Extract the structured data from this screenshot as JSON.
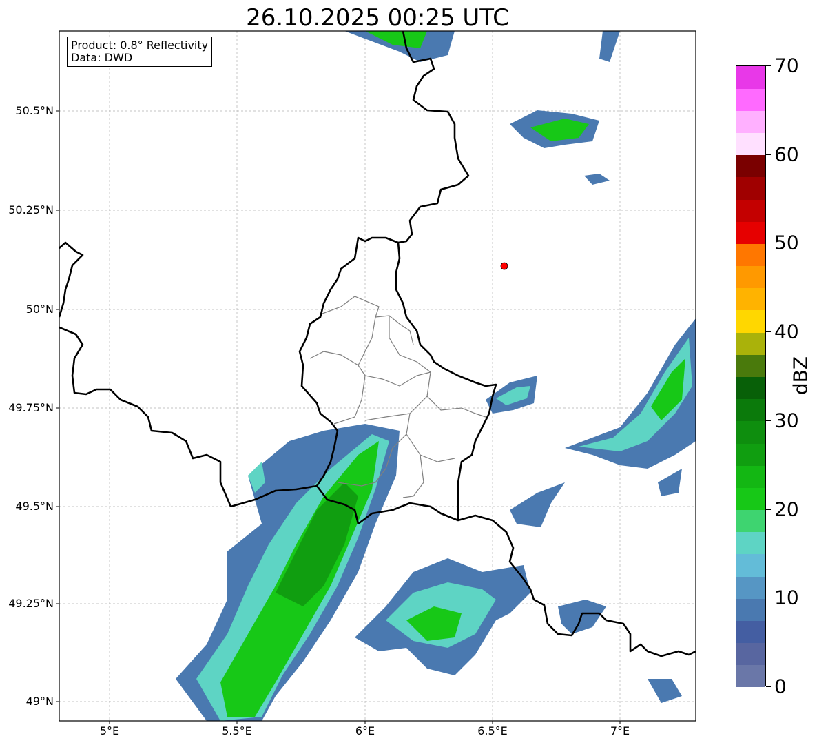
{
  "title": "26.10.2025 00:25 UTC",
  "info_box": {
    "product": "Product: 0.8° Reflectivity",
    "data": "Data: DWD"
  },
  "map": {
    "y_ticks": [
      "50.5°N",
      "50.25°N",
      "50°N",
      "49.75°N",
      "49.5°N",
      "49.25°N",
      "49°N"
    ],
    "x_ticks": [
      "5°E",
      "5.5°E",
      "6°E",
      "6.5°E",
      "7°E"
    ],
    "radar_site_color": "#ff0000",
    "border_color": "#000000",
    "district_color": "#808080"
  },
  "colorbar": {
    "unit": "dBZ",
    "tick_labels": [
      "0",
      "10",
      "20",
      "30",
      "40",
      "50",
      "60",
      "70"
    ],
    "colors": [
      "#6a77a8",
      "#5866a0",
      "#445ea2",
      "#4a79b0",
      "#5696c4",
      "#63bcd8",
      "#5ed4c4",
      "#3ed470",
      "#17c817",
      "#13b713",
      "#109e10",
      "#0e8e0e",
      "#0b7a0b",
      "#086008",
      "#4a7a0c",
      "#aab20a",
      "#ffd700",
      "#ffb300",
      "#ff9900",
      "#ff7700",
      "#e60000",
      "#c40000",
      "#a00000",
      "#7a0000",
      "#ffe0ff",
      "#ffb0ff",
      "#ff6aff",
      "#e838e8"
    ]
  }
}
